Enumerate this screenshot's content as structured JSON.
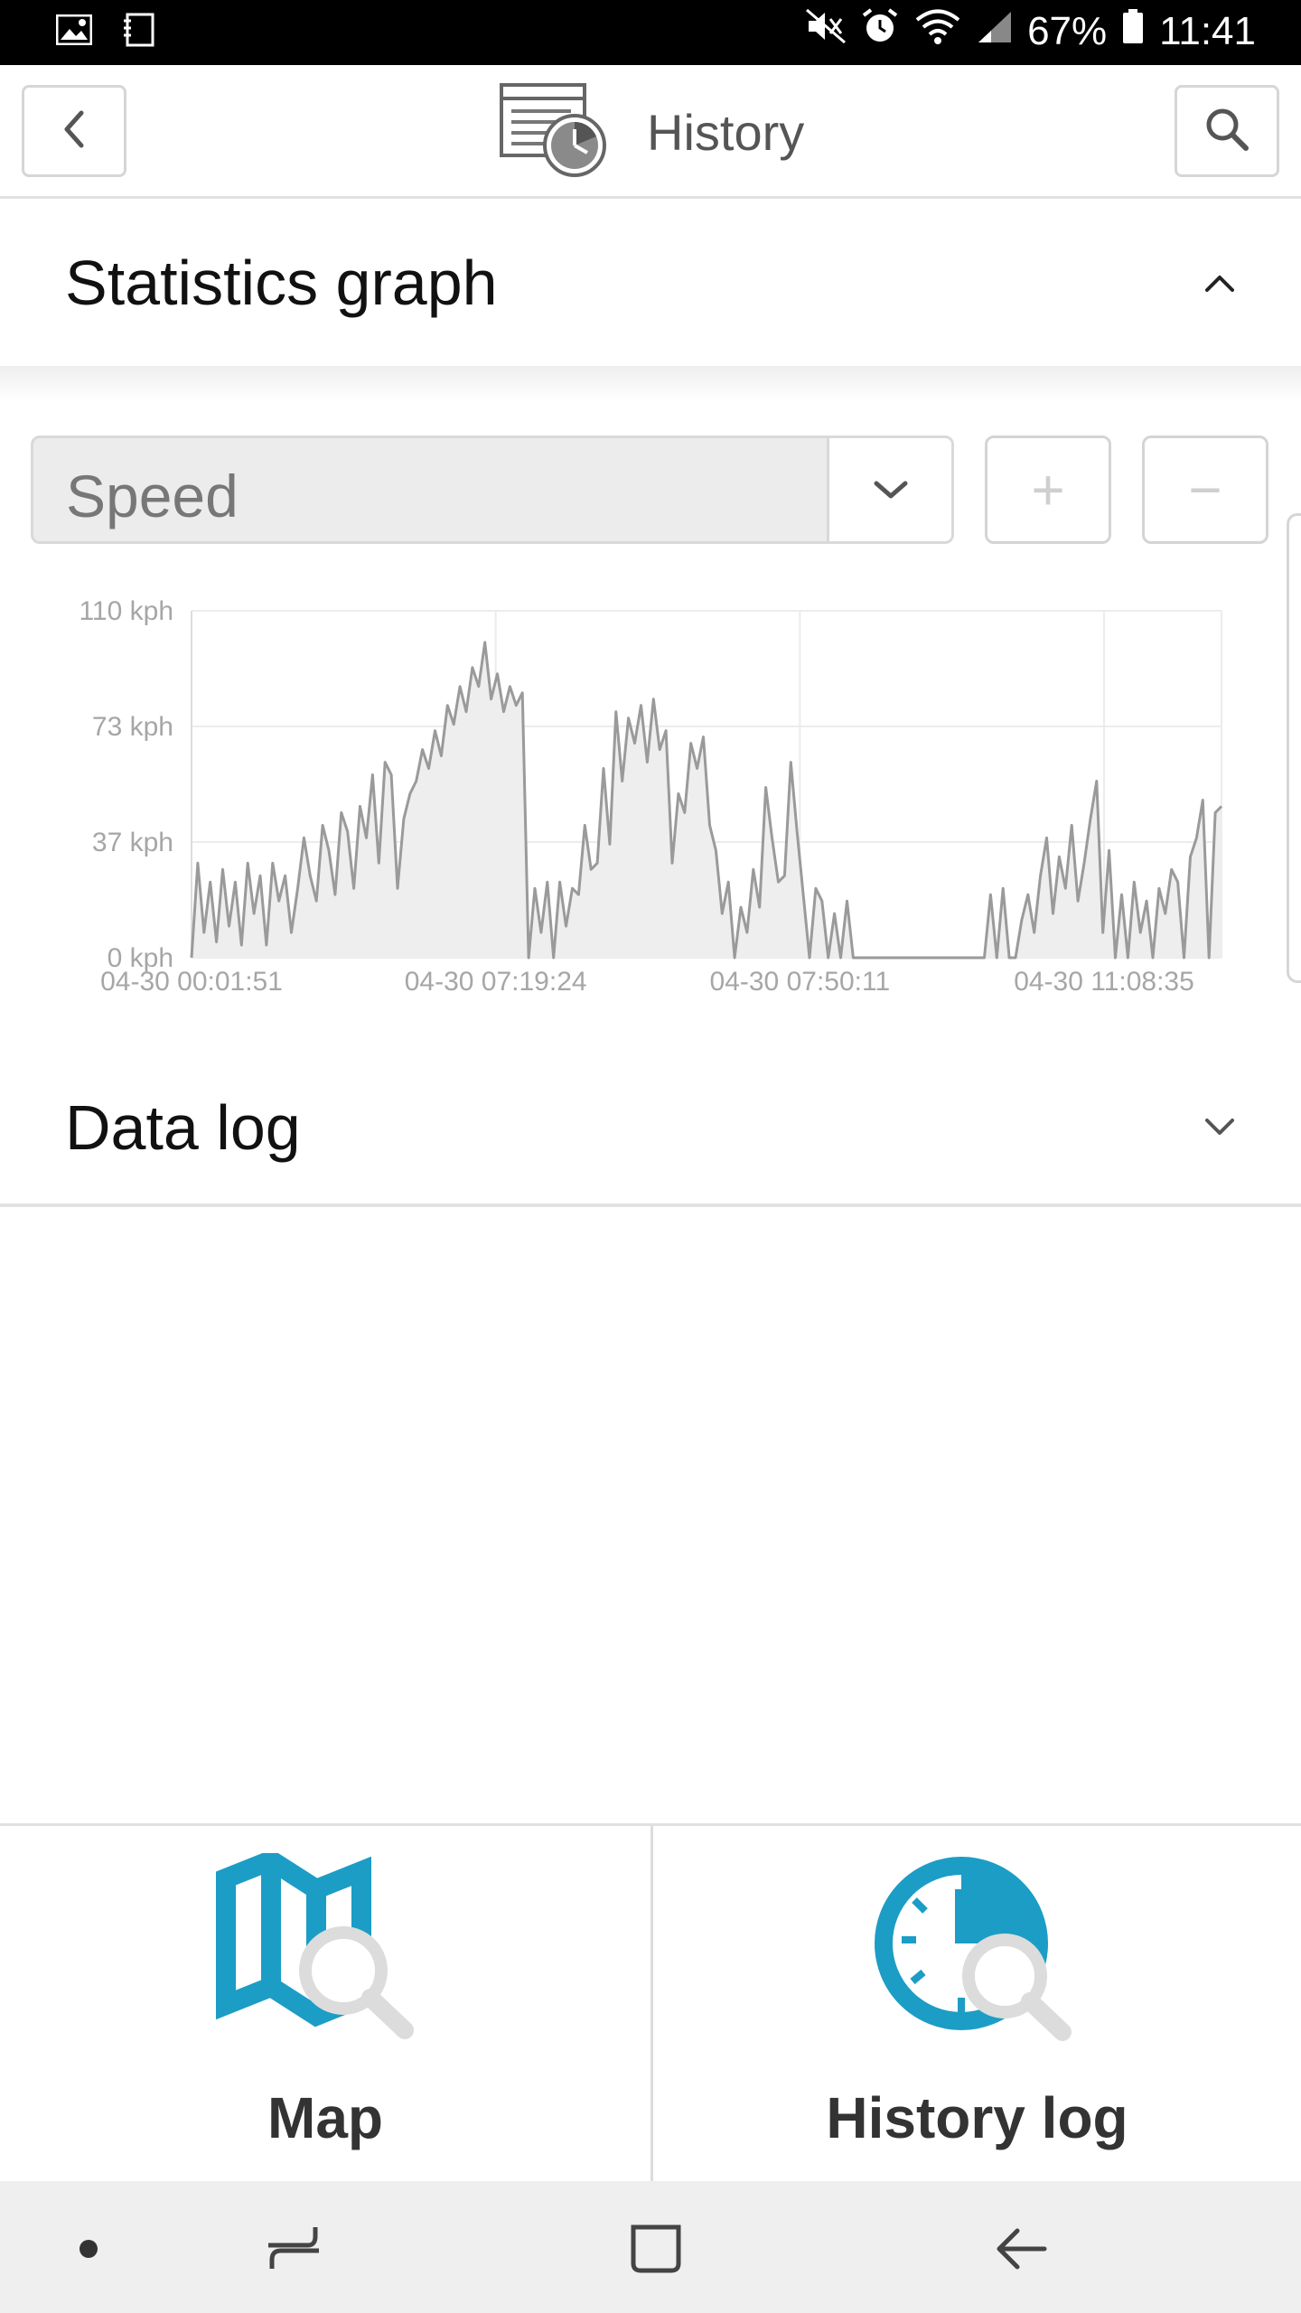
{
  "status_bar": {
    "battery": "67%",
    "time": "11:41",
    "icons": [
      "gallery-icon",
      "notes-icon",
      "mute-icon",
      "alarm-icon",
      "wifi-icon",
      "signal-icon",
      "battery-icon"
    ]
  },
  "header": {
    "title": "History",
    "back_icon": "chevron-left-icon",
    "search_icon": "search-icon",
    "title_icon": "history-report-icon"
  },
  "statistics": {
    "title": "Statistics graph",
    "toggle_icon": "chevron-up-icon",
    "metric": "Speed",
    "zoom_in_label": "+",
    "zoom_out_label": "−"
  },
  "chart_data": {
    "type": "area",
    "title": "",
    "xlabel": "",
    "ylabel": "",
    "ylim": [
      0,
      110
    ],
    "y_ticks": [
      "0 kph",
      "37 kph",
      "73 kph",
      "110 kph"
    ],
    "x_ticks": [
      "04-30 00:01:51",
      "04-30 07:19:24",
      "04-30 07:50:11",
      "04-30 11:08:35"
    ],
    "grid": true,
    "line_color": "#9a9a9a",
    "fill_color": "#eeeeee",
    "values": [
      0,
      30,
      8,
      24,
      5,
      28,
      10,
      24,
      4,
      30,
      14,
      26,
      4,
      30,
      18,
      26,
      8,
      22,
      38,
      26,
      18,
      42,
      34,
      20,
      46,
      40,
      22,
      48,
      38,
      58,
      30,
      62,
      58,
      22,
      44,
      52,
      56,
      66,
      60,
      72,
      64,
      80,
      74,
      86,
      78,
      92,
      86,
      100,
      82,
      90,
      78,
      86,
      80,
      84,
      0,
      22,
      8,
      24,
      0,
      24,
      10,
      22,
      20,
      42,
      28,
      30,
      60,
      36,
      78,
      56,
      76,
      68,
      80,
      62,
      82,
      66,
      72,
      30,
      52,
      46,
      68,
      60,
      70,
      42,
      34,
      14,
      24,
      0,
      16,
      8,
      28,
      16,
      54,
      38,
      24,
      26,
      62,
      40,
      20,
      0,
      22,
      18,
      0,
      14,
      0,
      18,
      0,
      0,
      0,
      0,
      0,
      0,
      0,
      0,
      0,
      0,
      0,
      0,
      0,
      0,
      0,
      0,
      0,
      0,
      0,
      0,
      0,
      0,
      20,
      0,
      22,
      0,
      0,
      12,
      20,
      8,
      26,
      38,
      14,
      32,
      22,
      42,
      18,
      30,
      44,
      56,
      8,
      34,
      0,
      20,
      0,
      24,
      8,
      18,
      0,
      22,
      14,
      28,
      24,
      0,
      32,
      38,
      50,
      0,
      46,
      48
    ]
  },
  "data_log": {
    "title": "Data log",
    "toggle_icon": "chevron-down-icon"
  },
  "tiles": [
    {
      "label": "Map",
      "icon": "map-search-icon"
    },
    {
      "label": "History log",
      "icon": "clock-search-icon"
    }
  ],
  "nav_bar": {
    "icons": [
      "dot-icon",
      "recent-apps-icon",
      "home-icon",
      "back-arrow-icon"
    ]
  },
  "colors": {
    "accent": "#1b9dc6",
    "magnifier": "#dcdcdc"
  }
}
